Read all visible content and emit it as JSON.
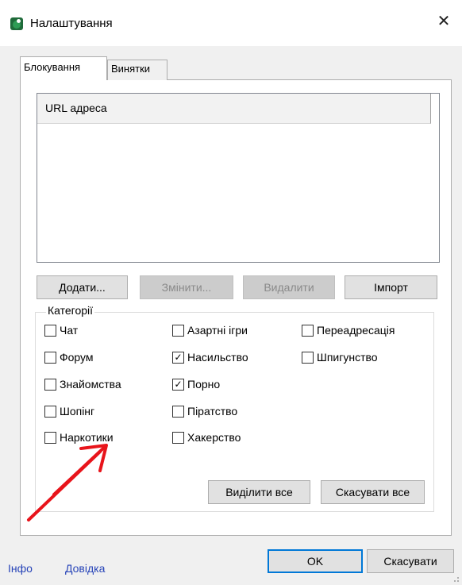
{
  "window": {
    "title": "Налаштування",
    "close_glyph": "✕",
    "icon": "app-icon"
  },
  "tabs": [
    {
      "label": "Блокування",
      "active": true
    },
    {
      "label": "Винятки",
      "active": false
    }
  ],
  "url_list": {
    "column_header": "URL адреса",
    "rows": []
  },
  "list_buttons": {
    "add": "Додати...",
    "edit": "Змінити...",
    "delete": "Видалити",
    "import": "Імпорт"
  },
  "categories": {
    "title": "Категорії",
    "items": [
      {
        "label": "Чат",
        "checked": false
      },
      {
        "label": "Форум",
        "checked": false
      },
      {
        "label": "Знайомства",
        "checked": false
      },
      {
        "label": "Шопінг",
        "checked": false
      },
      {
        "label": "Наркотики",
        "checked": false
      },
      {
        "label": "Азартні ігри",
        "checked": false
      },
      {
        "label": "Насильство",
        "checked": true
      },
      {
        "label": "Порно",
        "checked": true
      },
      {
        "label": "Піратство",
        "checked": false
      },
      {
        "label": "Хакерство",
        "checked": false
      },
      {
        "label": "Переадресація",
        "checked": false
      },
      {
        "label": "Шпигунство",
        "checked": false
      }
    ],
    "select_all": "Виділити все",
    "deselect_all": "Скасувати все"
  },
  "footer": {
    "info_link": "Інфо",
    "help_link": "Довідка",
    "ok": "OK",
    "cancel": "Скасувати"
  },
  "colors": {
    "link": "#2744b8",
    "annotation_arrow": "#e8141b",
    "ok_border": "#0078d7"
  }
}
